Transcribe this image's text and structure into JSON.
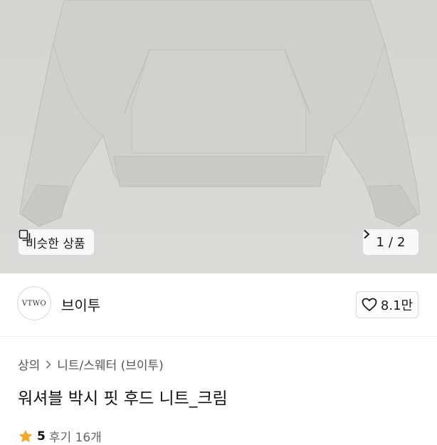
{
  "gallery": {
    "similar_label": "비슷한 상품",
    "page_current": "1",
    "page_separator": "/",
    "page_total": "2"
  },
  "seller": {
    "logo_text": "VTWO",
    "name": "브이투",
    "likes": "8.1만"
  },
  "breadcrumb": {
    "items": [
      "상의",
      "니트/스웨터 (브이투)"
    ]
  },
  "product": {
    "title": "워셔블 박시 핏 후드 니트_크림"
  },
  "review": {
    "score": "5",
    "count_label": "후기 16개"
  },
  "colors": {
    "star": "#f5a623",
    "background_photo": "#d6d6d3"
  }
}
